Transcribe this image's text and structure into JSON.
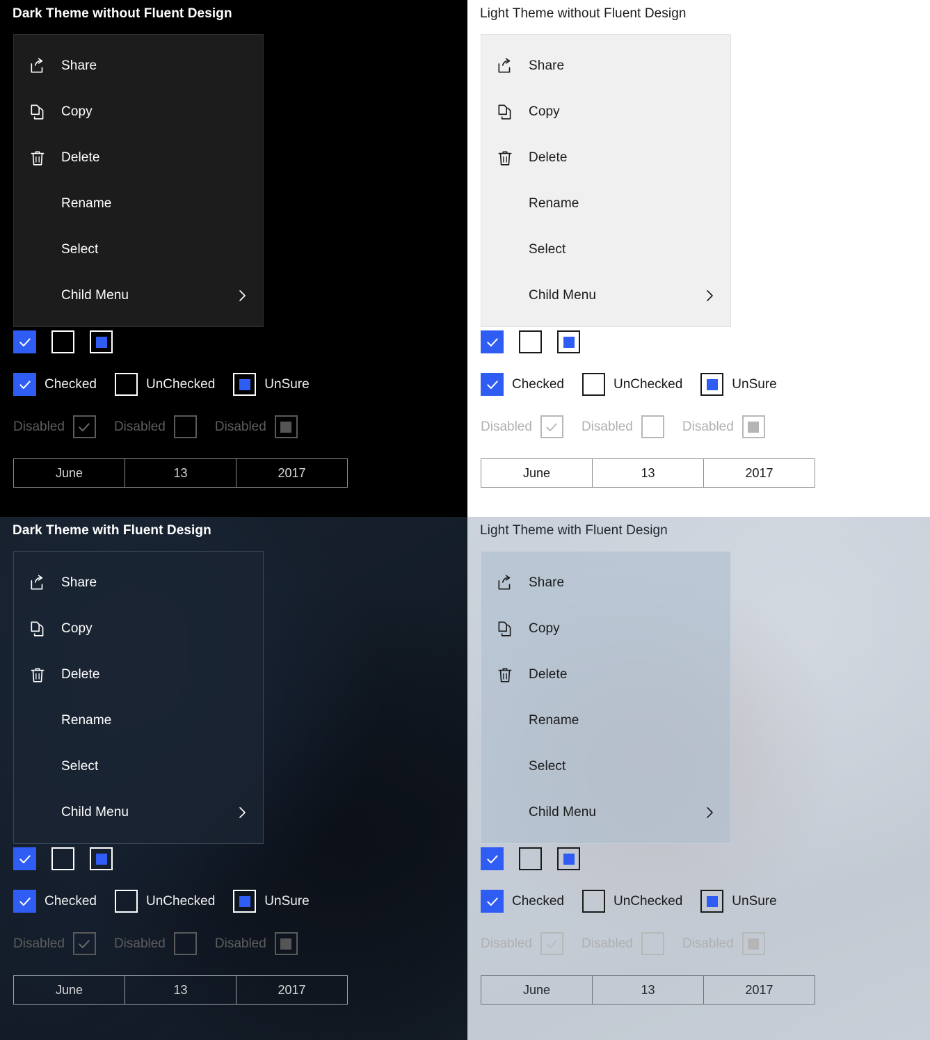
{
  "panels": [
    {
      "key": "dark_plain",
      "title": "Dark Theme without Fluent Design",
      "menu": {
        "items": [
          {
            "label": "Share",
            "icon": "share-icon"
          },
          {
            "label": "Copy",
            "icon": "copy-icon"
          },
          {
            "label": "Delete",
            "icon": "delete-icon"
          },
          {
            "label": "Rename",
            "icon": ""
          },
          {
            "label": "Select",
            "icon": ""
          },
          {
            "label": "Child Menu",
            "icon": "",
            "submenu_icon": "chevron-right-icon"
          }
        ]
      },
      "checkbox_row_icons": [
        {
          "state": "checked"
        },
        {
          "state": "unchecked"
        },
        {
          "state": "unsure"
        }
      ],
      "checkbox_row_labeled": [
        {
          "state": "checked",
          "label": "Checked"
        },
        {
          "state": "unchecked",
          "label": "UnChecked"
        },
        {
          "state": "unsure",
          "label": "UnSure"
        }
      ],
      "checkbox_row_disabled": [
        {
          "state": "checked",
          "label": "Disabled"
        },
        {
          "state": "unchecked",
          "label": "Disabled"
        },
        {
          "state": "unsure",
          "label": "Disabled"
        }
      ],
      "datepicker": {
        "month": "June",
        "day": "13",
        "year": "2017"
      }
    },
    {
      "key": "light_plain",
      "title": "Light Theme without Fluent Design",
      "menu": {
        "items": [
          {
            "label": "Share",
            "icon": "share-icon"
          },
          {
            "label": "Copy",
            "icon": "copy-icon"
          },
          {
            "label": "Delete",
            "icon": "delete-icon"
          },
          {
            "label": "Rename",
            "icon": ""
          },
          {
            "label": "Select",
            "icon": ""
          },
          {
            "label": "Child Menu",
            "icon": "",
            "submenu_icon": "chevron-right-icon"
          }
        ]
      },
      "checkbox_row_icons": [
        {
          "state": "checked"
        },
        {
          "state": "unchecked"
        },
        {
          "state": "unsure"
        }
      ],
      "checkbox_row_labeled": [
        {
          "state": "checked",
          "label": "Checked"
        },
        {
          "state": "unchecked",
          "label": "UnChecked"
        },
        {
          "state": "unsure",
          "label": "UnSure"
        }
      ],
      "checkbox_row_disabled": [
        {
          "state": "checked",
          "label": "Disabled"
        },
        {
          "state": "unchecked",
          "label": "Disabled"
        },
        {
          "state": "unsure",
          "label": "Disabled"
        }
      ],
      "datepicker": {
        "month": "June",
        "day": "13",
        "year": "2017"
      }
    },
    {
      "key": "dark_fluent",
      "title": "Dark Theme with Fluent Design",
      "menu": {
        "items": [
          {
            "label": "Share",
            "icon": "share-icon"
          },
          {
            "label": "Copy",
            "icon": "copy-icon"
          },
          {
            "label": "Delete",
            "icon": "delete-icon"
          },
          {
            "label": "Rename",
            "icon": ""
          },
          {
            "label": "Select",
            "icon": ""
          },
          {
            "label": "Child Menu",
            "icon": "",
            "submenu_icon": "chevron-right-icon"
          }
        ]
      },
      "checkbox_row_icons": [
        {
          "state": "checked"
        },
        {
          "state": "unchecked"
        },
        {
          "state": "unsure"
        }
      ],
      "checkbox_row_labeled": [
        {
          "state": "checked",
          "label": "Checked"
        },
        {
          "state": "unchecked",
          "label": "UnChecked"
        },
        {
          "state": "unsure",
          "label": "UnSure"
        }
      ],
      "checkbox_row_disabled": [
        {
          "state": "checked",
          "label": "Disabled"
        },
        {
          "state": "unchecked",
          "label": "Disabled"
        },
        {
          "state": "unsure",
          "label": "Disabled"
        }
      ],
      "datepicker": {
        "month": "June",
        "day": "13",
        "year": "2017"
      }
    },
    {
      "key": "light_fluent",
      "title": "Light Theme with Fluent Design",
      "menu": {
        "items": [
          {
            "label": "Share",
            "icon": "share-icon"
          },
          {
            "label": "Copy",
            "icon": "copy-icon"
          },
          {
            "label": "Delete",
            "icon": "delete-icon"
          },
          {
            "label": "Rename",
            "icon": ""
          },
          {
            "label": "Select",
            "icon": ""
          },
          {
            "label": "Child Menu",
            "icon": "",
            "submenu_icon": "chevron-right-icon"
          }
        ]
      },
      "checkbox_row_icons": [
        {
          "state": "checked"
        },
        {
          "state": "unchecked"
        },
        {
          "state": "unsure"
        }
      ],
      "checkbox_row_labeled": [
        {
          "state": "checked",
          "label": "Checked"
        },
        {
          "state": "unchecked",
          "label": "UnChecked"
        },
        {
          "state": "unsure",
          "label": "UnSure"
        }
      ],
      "checkbox_row_disabled": [
        {
          "state": "checked",
          "label": "Disabled"
        },
        {
          "state": "unchecked",
          "label": "Disabled"
        },
        {
          "state": "unsure",
          "label": "Disabled"
        }
      ],
      "datepicker": {
        "month": "June",
        "day": "13",
        "year": "2017"
      }
    }
  ],
  "colors": {
    "accent_blue": "#2f5df4",
    "dark_background": "#000000",
    "light_background": "#ffffff",
    "dark_menu_surface": "#1c1c1c",
    "light_menu_surface": "#f0f0f0",
    "dark_fluent_background": "#141d28",
    "light_fluent_background": "#c8cfd8",
    "disabled_dark_text": "#5d5d5d",
    "disabled_light_text": "#b0b0b0"
  }
}
